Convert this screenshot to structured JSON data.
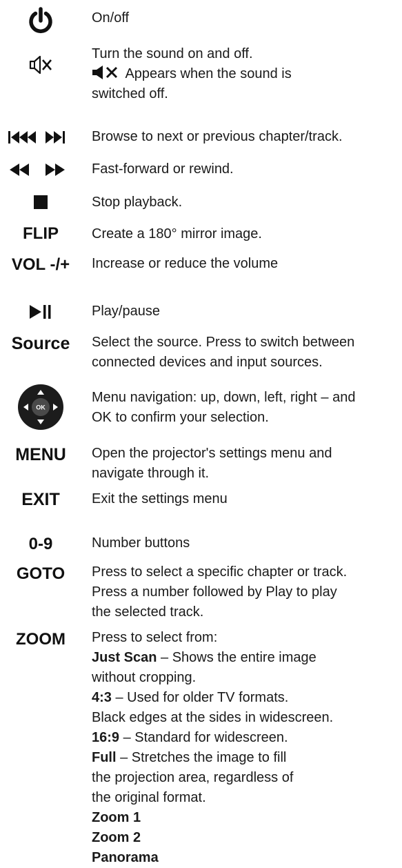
{
  "rows": {
    "power": {
      "icon": "power-icon",
      "desc": "On/off"
    },
    "mute": {
      "icon": "mute-icon",
      "desc1": "Turn the sound on and off.",
      "inline_icon": "speaker-muted-icon",
      "desc2": " Appears when the sound is",
      "desc3": "switched off."
    },
    "skip": {
      "icon": "skip-prev-next-icon",
      "desc": "Browse to next or previous chapter/track."
    },
    "ffrew": {
      "icon": "rewind-fastforward-icon",
      "desc": "Fast-forward or rewind."
    },
    "stop": {
      "icon": "stop-icon",
      "desc": "Stop playback."
    },
    "flip": {
      "key": "FLIP",
      "desc": "Create a 180° mirror image."
    },
    "vol": {
      "key": "VOL -/+",
      "desc": "Increase or reduce the volume"
    },
    "play": {
      "icon": "play-pause-icon",
      "desc": "Play/pause"
    },
    "source": {
      "key": "Source",
      "desc1": "Select the source. Press to switch between",
      "desc2": "connected devices and input sources."
    },
    "nav": {
      "icon": "navigation-pad-icon",
      "ok_label": "OK",
      "desc1": "Menu navigation: up, down, left, right – and",
      "desc2": "OK to confirm your selection."
    },
    "menu": {
      "key": "MENU",
      "desc1": "Open the projector's settings menu and",
      "desc2": "navigate through it."
    },
    "exit": {
      "key": "EXIT",
      "desc": "Exit the settings menu"
    },
    "numbers": {
      "key": "0-9",
      "desc": "Number buttons"
    },
    "goto": {
      "key": "GOTO",
      "desc1": "Press to select a specific chapter or track.",
      "desc2": "Press a number followed by Play to play",
      "desc3": "the selected track."
    },
    "zoom": {
      "key": "ZOOM",
      "intro": "Press to select from:",
      "just_scan_term": "Just Scan",
      "just_scan_desc1": " – Shows the entire image",
      "just_scan_desc2": "without cropping.",
      "ratio43_term": "4:3",
      "ratio43_desc1": " – Used for older TV formats.",
      "ratio43_desc2": "Black edges at the sides in widescreen.",
      "ratio169_term": "16:9",
      "ratio169_desc": " – Standard for widescreen.",
      "full_term": "Full",
      "full_desc1": " – Stretches the image to fill",
      "full_desc2": "the projection area, regardless of",
      "full_desc3": "the original format.",
      "zoom1": "Zoom 1",
      "zoom2": "Zoom 2",
      "panorama": "Panorama"
    }
  }
}
